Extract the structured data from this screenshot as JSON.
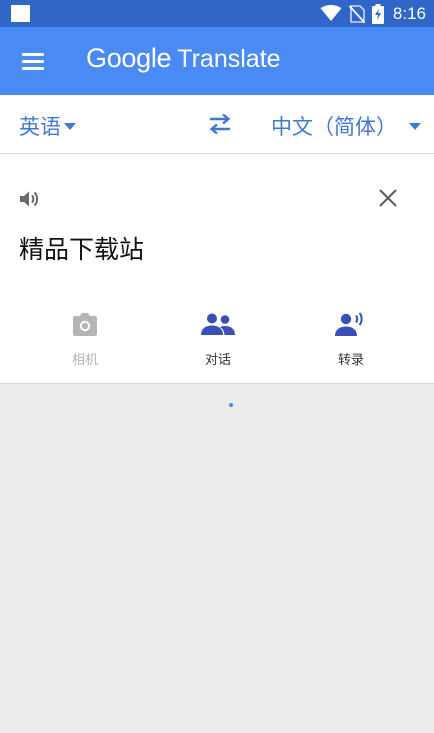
{
  "status_bar": {
    "time": "8:16"
  },
  "app_bar": {
    "title_part1": "Google",
    "title_part2": "Translate"
  },
  "languages": {
    "source": "英语",
    "target": "中文（简体）"
  },
  "input": {
    "text": "精品下载站"
  },
  "tools": {
    "camera": {
      "label": "相机",
      "icon": "camera-icon",
      "enabled": false
    },
    "conversation": {
      "label": "对话",
      "icon": "conversation-icon"
    },
    "transcribe": {
      "label": "转录",
      "icon": "transcribe-icon"
    }
  },
  "colors": {
    "status_bar": "#2f66c8",
    "app_bar": "#4a8af4",
    "accent": "#4178d4",
    "tool_icon": "#3b4fb8",
    "background": "#ececec"
  }
}
